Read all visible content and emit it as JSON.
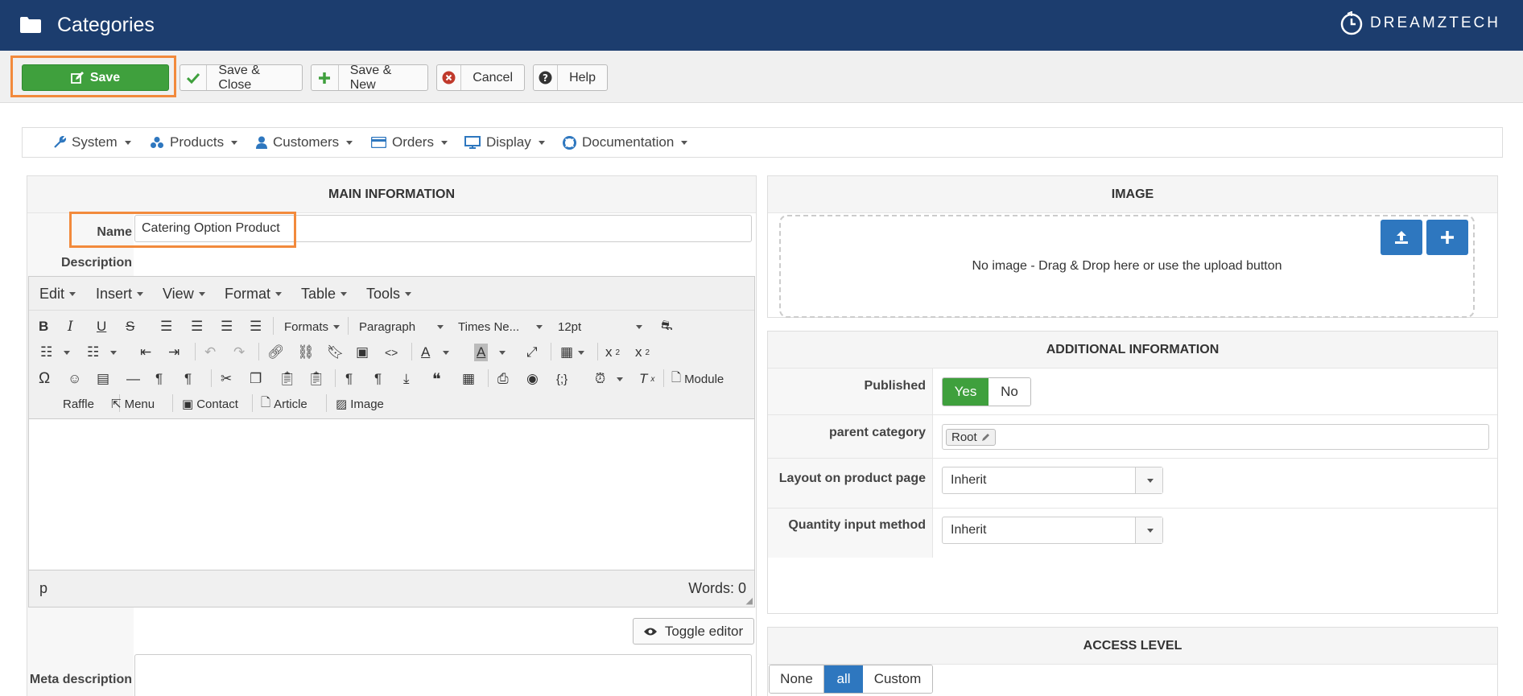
{
  "header": {
    "title": "Categories",
    "brand": "DREAMZTECH"
  },
  "toolbar": {
    "save": "Save",
    "save_close": "Save & Close",
    "save_new": "Save & New",
    "cancel": "Cancel",
    "help": "Help"
  },
  "nav": [
    "System",
    "Products",
    "Customers",
    "Orders",
    "Display",
    "Documentation"
  ],
  "main_info": {
    "heading": "MAIN INFORMATION",
    "name_label": "Name",
    "name_value": "Catering Option Product",
    "description_label": "Description",
    "meta_description_label": "Meta description",
    "toggle_editor": "Toggle editor"
  },
  "editor": {
    "menus": [
      "Edit",
      "Insert",
      "View",
      "Format",
      "Table",
      "Tools"
    ],
    "formats": "Formats",
    "paragraph": "Paragraph",
    "font": "Times Ne...",
    "size": "12pt",
    "module": "Module",
    "raffle": "Raffle",
    "menu": "Menu",
    "contact": "Contact",
    "article": "Article",
    "image": "Image",
    "path": "p",
    "words": "Words: 0"
  },
  "image_panel": {
    "heading": "IMAGE",
    "dropzone_text": "No image - Drag & Drop here or use the upload button"
  },
  "additional": {
    "heading": "ADDITIONAL INFORMATION",
    "published_label": "Published",
    "yes": "Yes",
    "no": "No",
    "parent_label": "parent category",
    "parent_value": "Root",
    "layout_label": "Layout on product page",
    "layout_value": "Inherit",
    "quantity_label": "Quantity input method",
    "quantity_value": "Inherit"
  },
  "access": {
    "heading": "ACCESS LEVEL",
    "none": "None",
    "all": "all",
    "custom": "Custom"
  },
  "colors": {
    "header_bg": "#1c3d6e",
    "save_green": "#3fa03d",
    "accent_blue": "#2e77bf",
    "highlight_orange": "#f28a3c"
  }
}
